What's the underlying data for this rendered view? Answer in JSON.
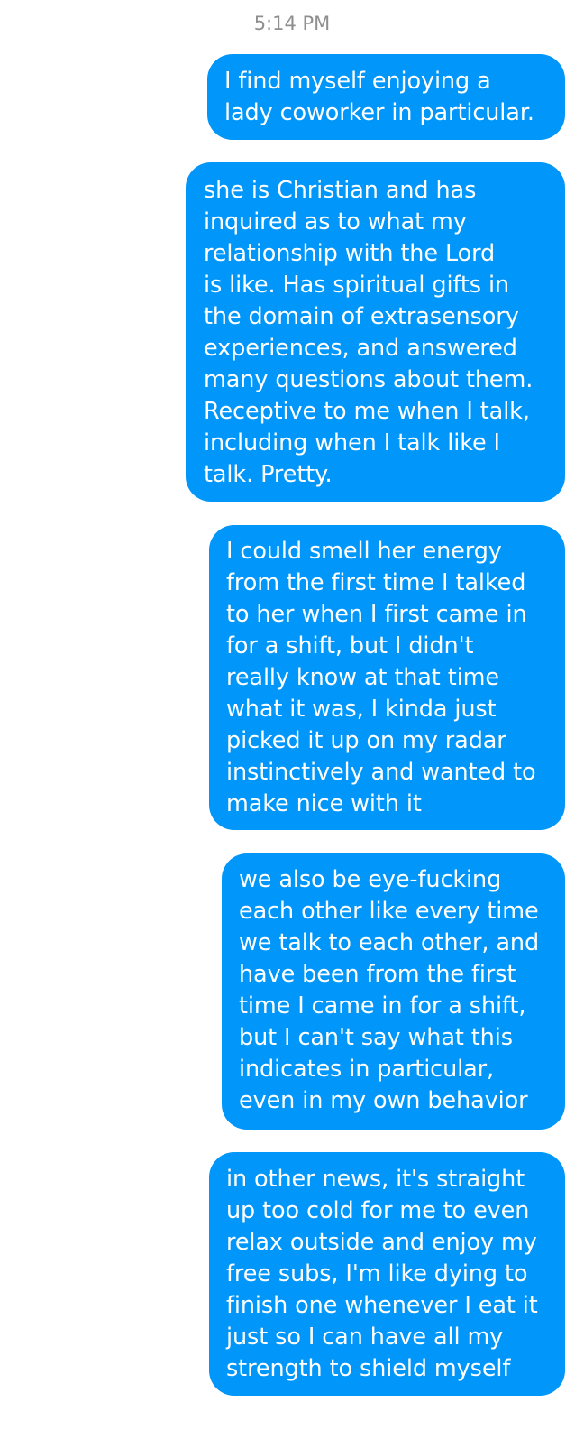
{
  "conversation": {
    "timestamp": "5:14 PM",
    "accent_color": "#0096fa",
    "messages": [
      {
        "sender": "self",
        "text": "I find myself enjoying a\nlady coworker in particular."
      },
      {
        "sender": "self",
        "text": "she is Christian and has\ninquired as to what my\nrelationship with the Lord\nis like. Has spiritual gifts in\nthe domain of extrasensory\nexperiences, and answered\nmany questions about them.\nReceptive to me when I talk,\nincluding when I talk like I\ntalk. Pretty."
      },
      {
        "sender": "self",
        "text": "I could smell her energy\nfrom the first time I talked\nto her when I first came in\nfor a shift, but I didn't\nreally know at that time\nwhat it was, I kinda just\npicked it up on my radar\ninstinctively and wanted to\nmake nice with it"
      },
      {
        "sender": "self",
        "text": "we also be eye-fucking\neach other like every time\nwe talk to each other, and\nhave been from the first\ntime I came in for a shift,\nbut I can't say what this\nindicates in particular,\neven in my own behavior"
      },
      {
        "sender": "self",
        "text": "in other news, it's straight\nup too cold for me to even\nrelax outside and enjoy my\nfree subs, I'm like dying to\nfinish one whenever I eat it\njust so I can have all my\nstrength to shield myself"
      }
    ]
  }
}
